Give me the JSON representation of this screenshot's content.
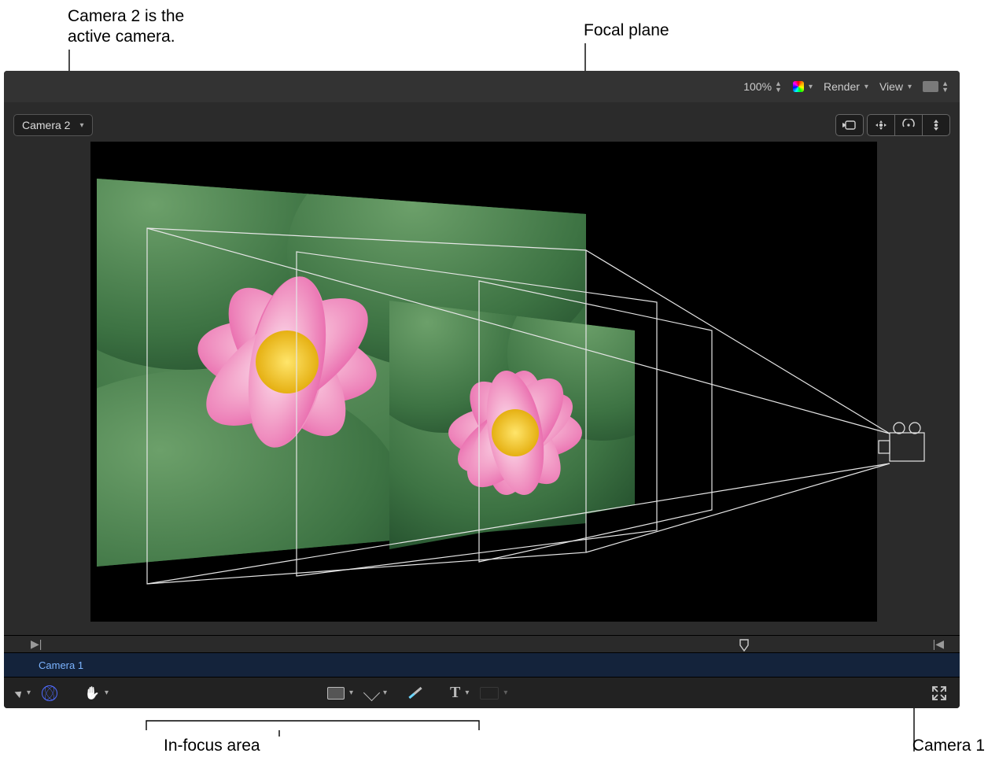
{
  "top_bar": {
    "zoom": "100%",
    "render": "Render",
    "view": "View"
  },
  "camera_select": {
    "label": "Camera 2"
  },
  "timeline": {
    "clip_name": "Camera 1",
    "start_marker": "▶|",
    "end_marker": "|◀",
    "playhead": "⎔"
  },
  "tools": {
    "text_label": "T"
  },
  "annotations": {
    "active_camera": "Camera 2 is the\nactive camera.",
    "focal_plane": "Focal plane",
    "in_focus_area": "In-focus area",
    "camera1": "Camera 1"
  },
  "icons": {
    "color_swatch": "color-swatch-icon",
    "gray_swatch": "gray-swatch-icon"
  }
}
